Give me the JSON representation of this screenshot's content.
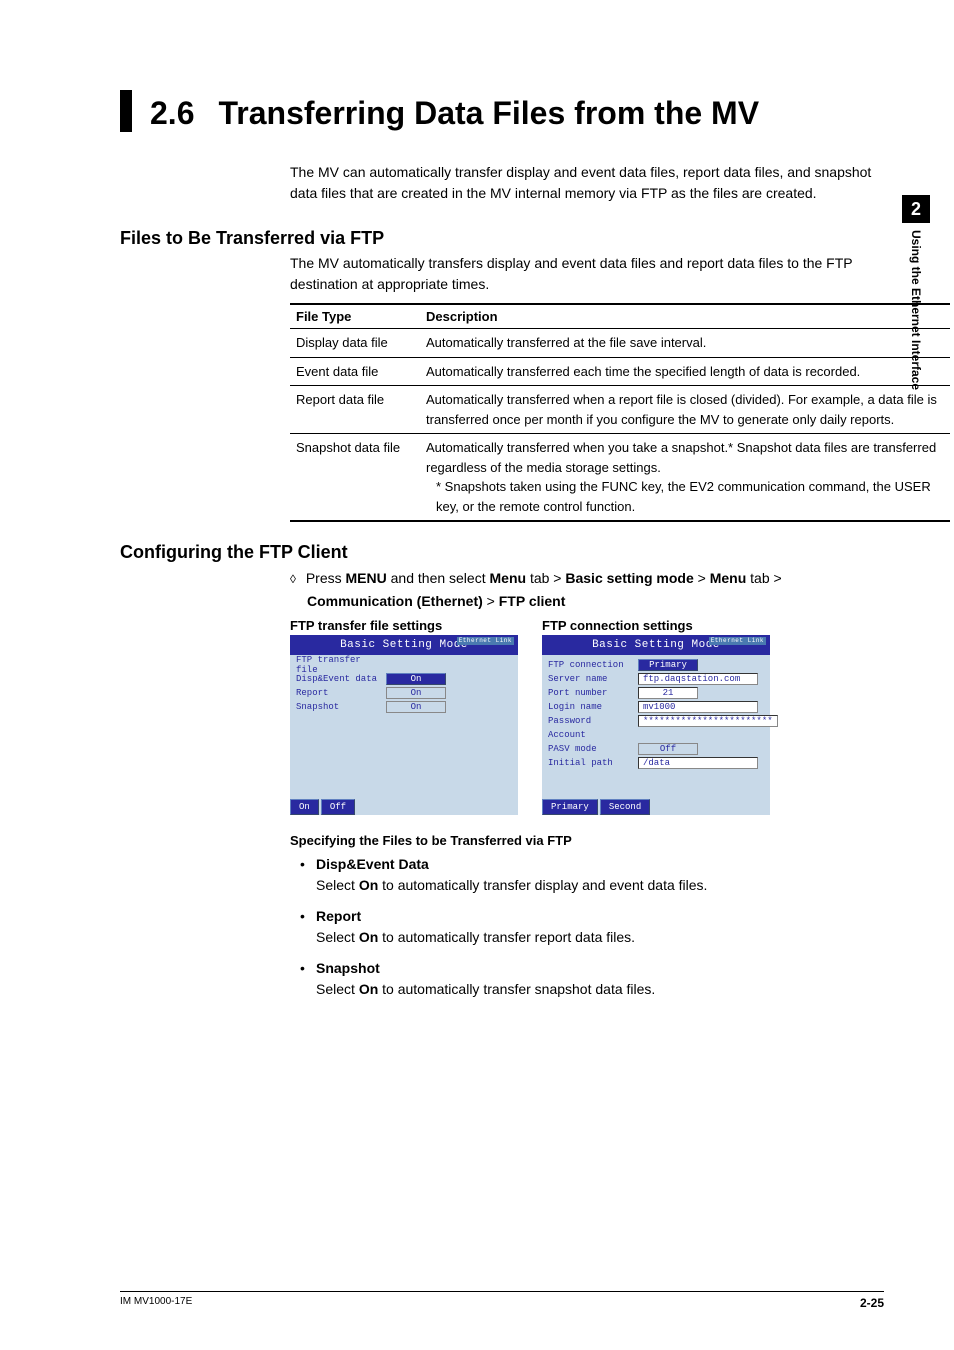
{
  "side": {
    "chapter_num": "2",
    "chapter_label": "Using the Ethernet Interface"
  },
  "title": {
    "num": "2.6",
    "text": "Transferring Data Files from the MV"
  },
  "intro": "The MV can automatically transfer display and event data files, report data files, and snapshot data files that are created in the MV internal memory via FTP as the files are created.",
  "sec1": {
    "heading": "Files to Be Transferred via FTP",
    "intro": "The MV automatically transfers display and event data files and report data files to the FTP destination at appropriate times.",
    "th1": "File Type",
    "th2": "Description",
    "rows": [
      {
        "c1": "Display data file",
        "c2": "Automatically transferred at the file save interval."
      },
      {
        "c1": "Event data file",
        "c2": "Automatically transferred each time the specified length of data is recorded."
      },
      {
        "c1": "Report data file",
        "c2": "Automatically transferred when a report file is closed (divided). For example, a data file is transferred once per month if you configure the MV to generate only daily reports."
      },
      {
        "c1": "Snapshot data file",
        "c2": "Automatically transferred when you take a snapshot.* Snapshot data files are transferred regardless of the media storage settings.",
        "c2b": "* Snapshots taken using the FUNC key, the EV2 communication command, the USER key, or the remote control function."
      }
    ]
  },
  "sec2": {
    "heading": "Configuring the FTP Client",
    "nav_prefix": "Press ",
    "nav": {
      "b1": "MENU",
      "t1": " and then select ",
      "b2": "Menu",
      "t2": " tab > ",
      "b3": "Basic setting mode",
      "t3": " > ",
      "b4": "Menu",
      "t4": " tab > ",
      "b5": "Communication (Ethernet)",
      "t5": " > ",
      "b6": "FTP client"
    },
    "left_title": "FTP transfer file settings",
    "right_title": "FTP connection settings",
    "screen_header": "Basic Setting Mode",
    "eth_badge": "Ethernet\nLink",
    "left": {
      "heading": "FTP transfer file",
      "r1l": "Disp&Event data",
      "r1v": "On",
      "r2l": "Report",
      "r2v": "On",
      "r3l": "Snapshot",
      "r3v": "On",
      "f1": "On",
      "f2": "Off"
    },
    "right": {
      "r0l": "FTP connection",
      "r0v": "Primary",
      "r1l": "Server name",
      "r1v": "ftp.daqstation.com",
      "r2l": "Port number",
      "r2v": "21",
      "r3l": "Login name",
      "r3v": "mv1000",
      "r4l": "Password",
      "r4v": "************************",
      "r5l": "Account",
      "r5v": "",
      "r6l": "PASV mode",
      "r6v": "Off",
      "r7l": "Initial path",
      "r7v": "/data",
      "f1": "Primary",
      "f2": "Second"
    }
  },
  "spec": {
    "heading": "Specifying the Files to be Transferred via FTP",
    "items": [
      {
        "label": "Disp&Event Data",
        "desc_a": "Select ",
        "desc_b": "On",
        "desc_c": " to automatically transfer display and event data files."
      },
      {
        "label": "Report",
        "desc_a": "Select ",
        "desc_b": "On",
        "desc_c": " to automatically transfer report data files."
      },
      {
        "label": "Snapshot",
        "desc_a": "Select ",
        "desc_b": "On",
        "desc_c": " to automatically transfer snapshot data files."
      }
    ]
  },
  "footer": {
    "doc": "IM MV1000-17E",
    "page": "2-25"
  }
}
